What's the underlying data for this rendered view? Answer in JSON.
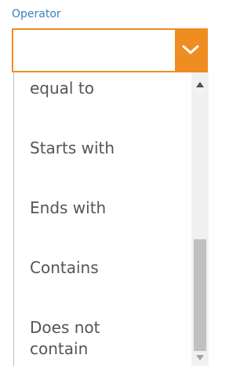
{
  "field": {
    "label": "Operator",
    "value": ""
  },
  "dropdown": {
    "options": [
      {
        "label": "equal to"
      },
      {
        "label": "Starts with"
      },
      {
        "label": "Ends with"
      },
      {
        "label": "Contains"
      },
      {
        "label": "Does not contain"
      }
    ]
  },
  "icons": {
    "toggle": "chevron-down-icon",
    "scroll_up": "arrow-up-icon",
    "scroll_down": "arrow-down-icon"
  },
  "colors": {
    "accent": "#ef8d21",
    "label": "#3a7fc1"
  }
}
